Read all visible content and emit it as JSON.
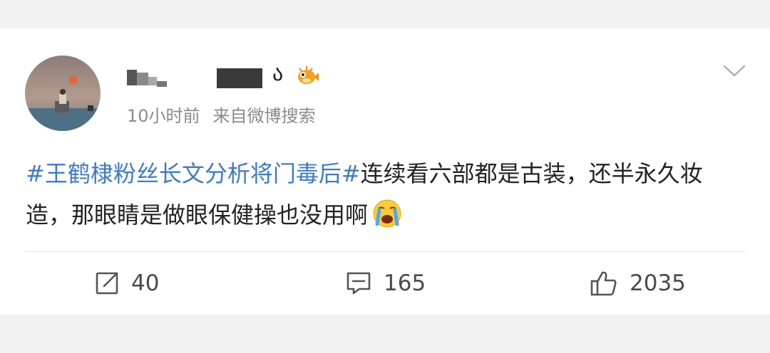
{
  "post": {
    "timestamp": "10小时前",
    "source": "来自微博搜索",
    "topic": "#王鹤棣粉丝长文分析将门毒后#",
    "text": "连续看六部都是古装，还半永久妆造，那眼睛是做眼保健操也没用啊",
    "emoji": "crying-face-icon"
  },
  "user": {
    "name_fragment": "ა",
    "badge": "pufferfish-badge-icon",
    "avatar": "avatar-sunset-person"
  },
  "actions": {
    "repost_count": "40",
    "comment_count": "165",
    "like_count": "2035"
  },
  "colors": {
    "topic": "#3e7bc7",
    "text": "#222222",
    "meta": "#8a8a8a",
    "background": "#f2f2f2"
  }
}
